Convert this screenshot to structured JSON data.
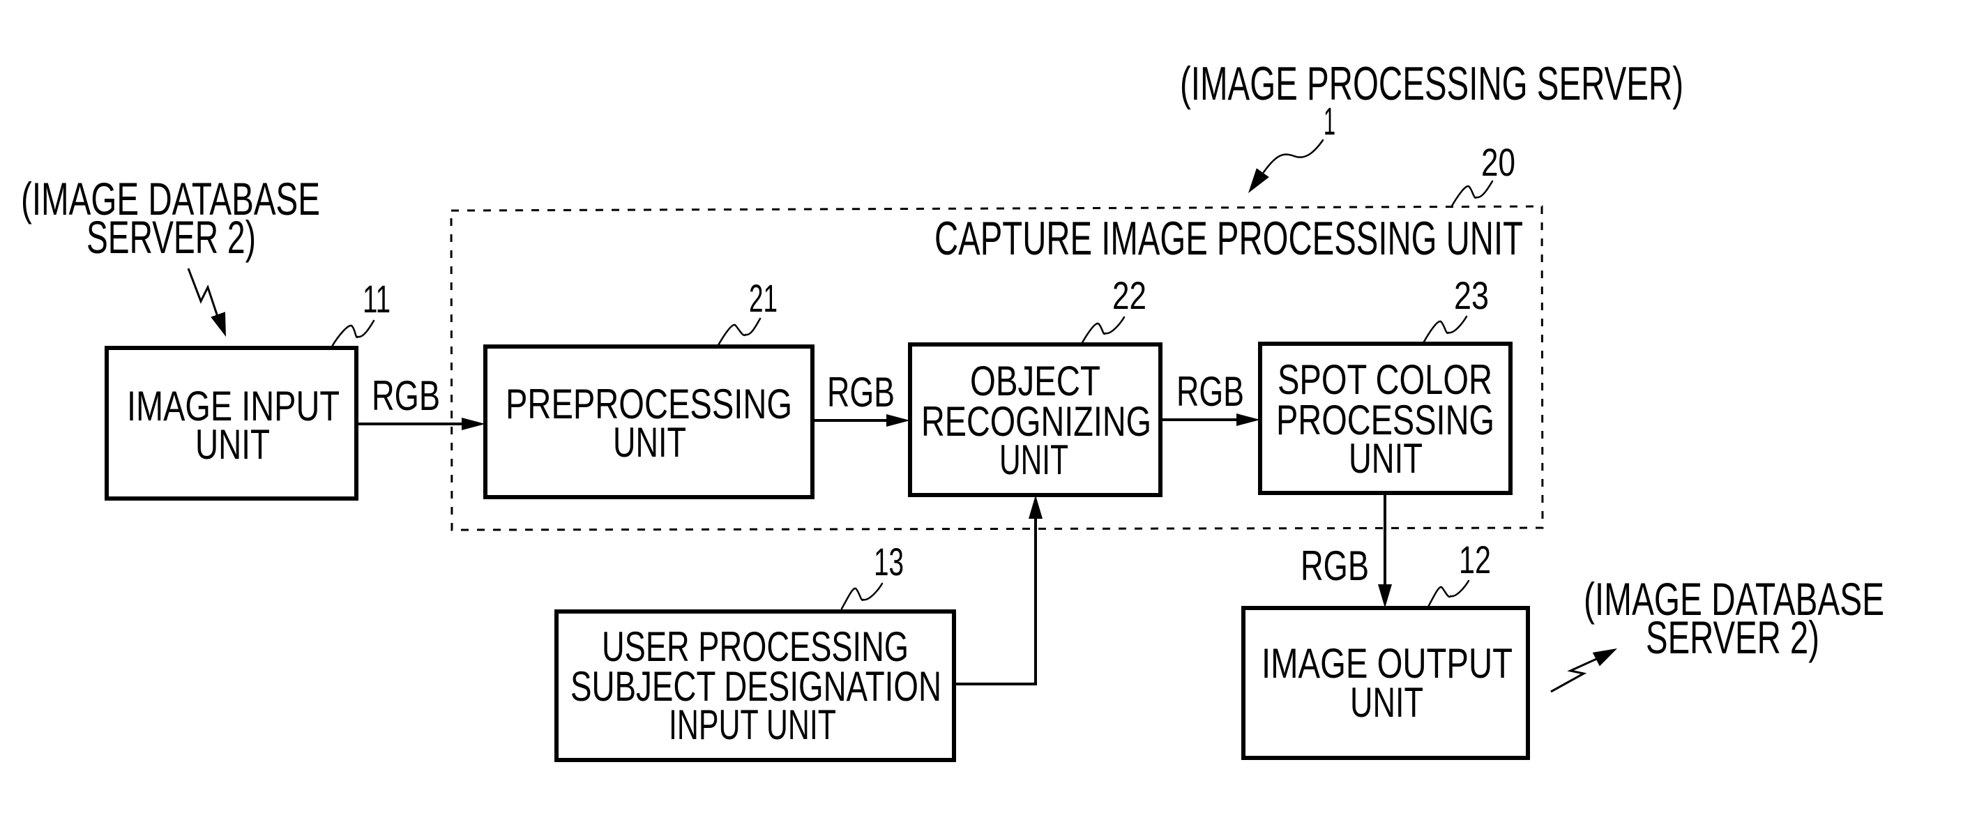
{
  "figure": {
    "server_caption": "(IMAGE PROCESSING SERVER)",
    "server_ref": "1",
    "group": {
      "ref": "20",
      "caption": "CAPTURE IMAGE PROCESSING UNIT"
    },
    "external_source": {
      "lines": [
        "(IMAGE DATABASE",
        "SERVER 2)"
      ]
    },
    "external_destination": {
      "lines": [
        "(IMAGE DATABASE",
        "SERVER 2)"
      ]
    },
    "units": [
      {
        "id": "image-input-unit",
        "ref": "11",
        "lines": [
          "IMAGE INPUT",
          "UNIT"
        ]
      },
      {
        "id": "preprocessing-unit",
        "ref": "21",
        "lines": [
          "PREPROCESSING",
          "UNIT"
        ]
      },
      {
        "id": "object-recognizing-unit",
        "ref": "22",
        "lines": [
          "OBJECT",
          "RECOGNIZING",
          "UNIT"
        ]
      },
      {
        "id": "spot-color-processing-unit",
        "ref": "23",
        "lines": [
          "SPOT COLOR",
          "PROCESSING",
          "UNIT"
        ]
      },
      {
        "id": "user-processing-subject-designation-input-unit",
        "ref": "13",
        "lines": [
          "USER PROCESSING",
          "SUBJECT DESIGNATION",
          "INPUT UNIT"
        ]
      },
      {
        "id": "image-output-unit",
        "ref": "12",
        "lines": [
          "IMAGE OUTPUT",
          "UNIT"
        ]
      }
    ],
    "connections": [
      {
        "from": "image-input-unit",
        "to": "preprocessing-unit",
        "label": "RGB"
      },
      {
        "from": "preprocessing-unit",
        "to": "object-recognizing-unit",
        "label": "RGB"
      },
      {
        "from": "object-recognizing-unit",
        "to": "spot-color-processing-unit",
        "label": "RGB"
      },
      {
        "from": "spot-color-processing-unit",
        "to": "image-output-unit",
        "label": "RGB"
      },
      {
        "from": "user-processing-subject-designation-input-unit",
        "to": "object-recognizing-unit",
        "label": ""
      }
    ]
  }
}
